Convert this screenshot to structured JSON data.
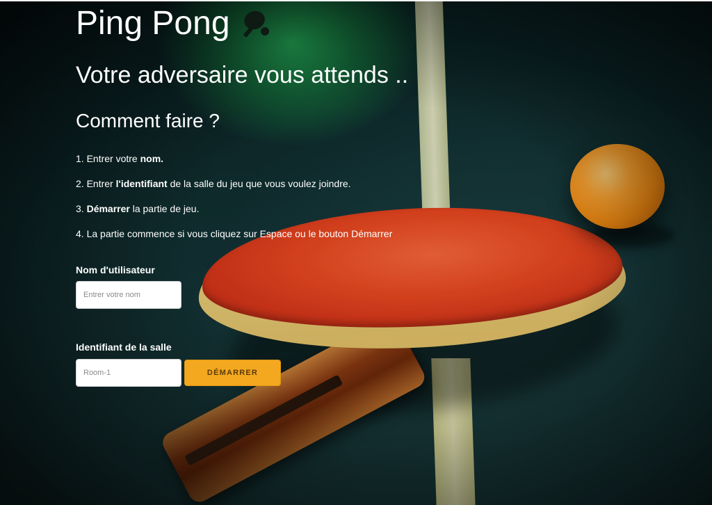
{
  "header": {
    "app_title": "Ping Pong",
    "title_icon": "ping-pong-paddle-icon",
    "subtitle": "Votre adversaire vous attends .."
  },
  "instructions": {
    "heading": "Comment faire ?",
    "steps": [
      {
        "prefix": "1. Entrer votre ",
        "bold": "nom.",
        "suffix": ""
      },
      {
        "prefix": "2. Entrer ",
        "bold": "l'identifiant",
        "suffix": " de la salle du jeu que vous voulez joindre."
      },
      {
        "prefix": "3. ",
        "bold": "Démarrer",
        "suffix": " la partie de jeu."
      },
      {
        "prefix": "4. La partie commence si vous cliquez sur Espace ou le bouton Démarrer",
        "bold": "",
        "suffix": ""
      }
    ]
  },
  "form": {
    "username_label": "Nom d'utilisateur",
    "username_placeholder": "Entrer votre nom",
    "username_value": "",
    "room_label": "Identifiant de la salle",
    "room_placeholder": "Room-1",
    "room_value": "",
    "start_label": "Démarrer"
  },
  "colors": {
    "start_button": "#f4a81f",
    "text": "#ffffff"
  }
}
